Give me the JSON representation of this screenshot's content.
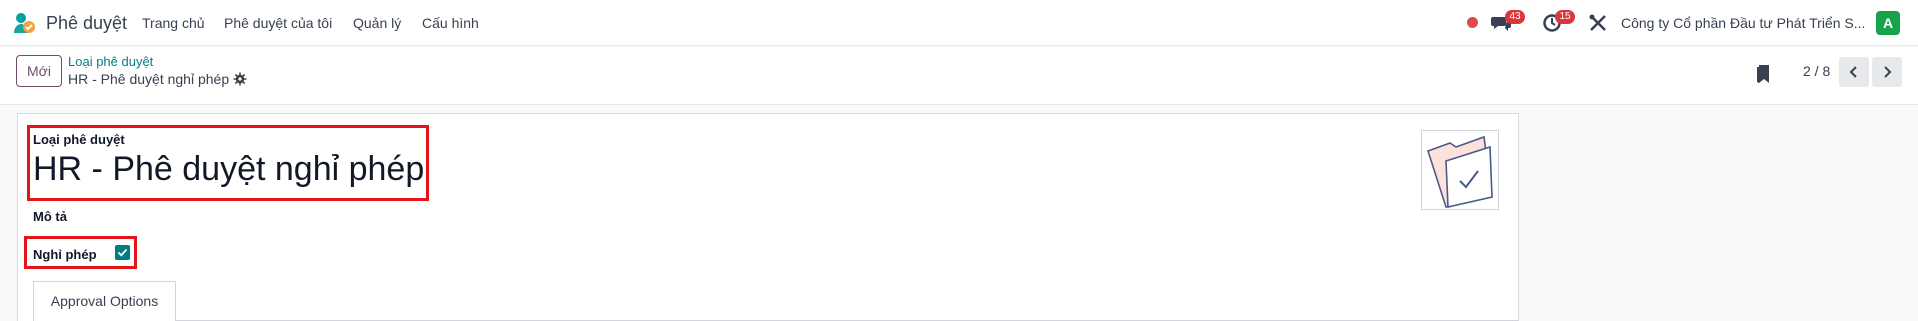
{
  "app": {
    "name": "Phê duyệt",
    "logo": "approvals-logo-icon"
  },
  "menu": [
    "Trang chủ",
    "Phê duyệt của tôi",
    "Quản lý",
    "Cấu hình"
  ],
  "systray": {
    "recording_dot_color": "#e04a4a",
    "messages_count": "43",
    "activities_count": "15",
    "company": "Công ty Cổ phần Đầu tư Phát Triển S...",
    "avatar_letter": "A"
  },
  "control": {
    "new_label": "Mới",
    "breadcrumb_parent": "Loại phê duyệt",
    "breadcrumb_current": "HR - Phê duyệt nghỉ phép",
    "pager": "2 / 8"
  },
  "form": {
    "type_label": "Loại phê duyệt",
    "name": "HR - Phê duyệt nghỉ phép",
    "description_label": "Mô tả",
    "leave_label": "Nghỉ phép",
    "leave_checked": true,
    "tabs": [
      "Approval Options"
    ]
  },
  "colors": {
    "accent": "#017e84",
    "brand": "#714b67",
    "badge": "#d9363e",
    "highlight": "#e3141a",
    "avatar": "#16a34a"
  }
}
